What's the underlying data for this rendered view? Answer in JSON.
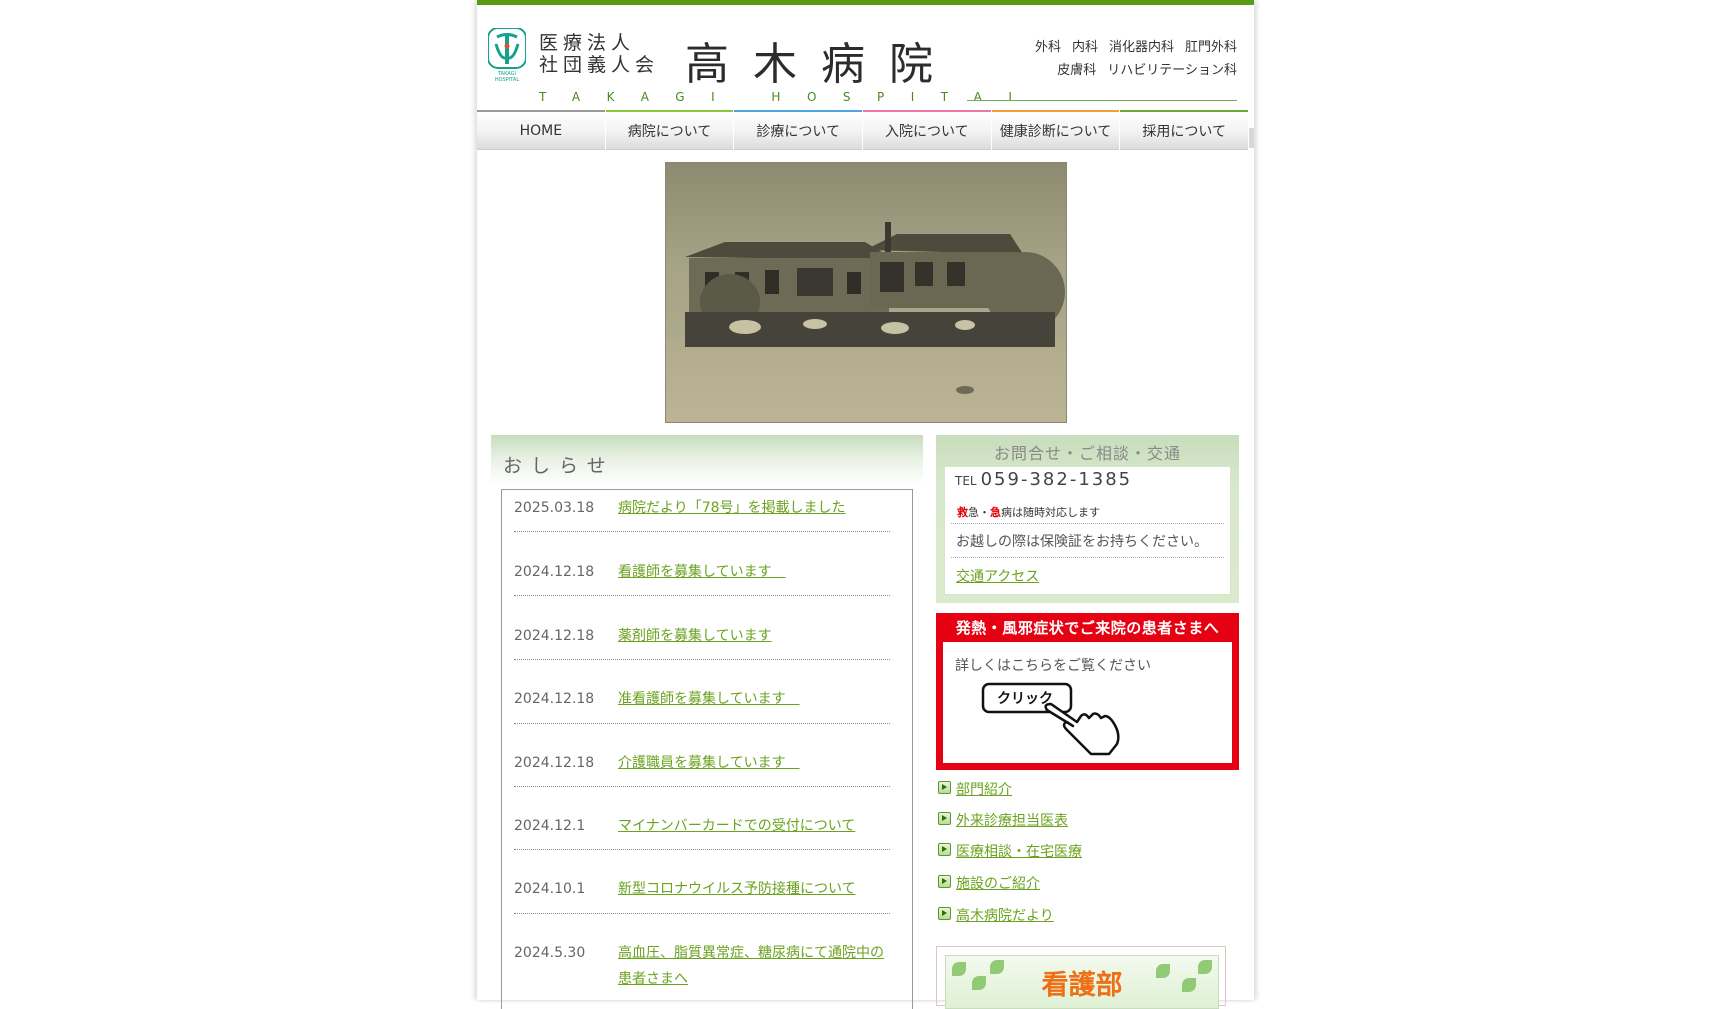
{
  "header": {
    "corp_line1": "医療法人",
    "corp_line2": "社団義人会",
    "hospital_name": "高木病院",
    "roman": "TAKAGI HOSPITAL",
    "logo_caption": "TAKAGI HOSPITAL",
    "departments_line1": [
      "外科",
      "内科",
      "消化器内科",
      "肛門外科"
    ],
    "departments_line2": [
      "皮膚科",
      "リハビリテーション科"
    ]
  },
  "nav": [
    {
      "label": "HOME",
      "accent": "#999999"
    },
    {
      "label": "病院について",
      "accent": "#8cc63f"
    },
    {
      "label": "診療について",
      "accent": "#4fa3e0"
    },
    {
      "label": "入院について",
      "accent": "#ec77a8"
    },
    {
      "label": "健康診断について",
      "accent": "#f39c3c"
    },
    {
      "label": "採用について",
      "accent": "#6aaa3a"
    }
  ],
  "news": {
    "title": "おしらせ",
    "items": [
      {
        "date": "2025.03.18",
        "text": "病院だより「78号」を掲載しました"
      },
      {
        "date": "2024.12.18",
        "text": "看護師を募集しています　"
      },
      {
        "date": "2024.12.18",
        "text": "薬剤師を募集しています"
      },
      {
        "date": "2024.12.18",
        "text": "准看護師を募集しています　"
      },
      {
        "date": "2024.12.18",
        "text": "介護職員を募集しています　"
      },
      {
        "date": "2024.12.1",
        "text": "マイナンバーカードでの受付について"
      },
      {
        "date": "2024.10.1",
        "text": "新型コロナウイルス予防接種について"
      },
      {
        "date": "2024.5.30",
        "text": "高血圧、脂質異常症、糖尿病にて通院中の患者さまへ"
      }
    ]
  },
  "contact": {
    "title": "お問合せ・ご相談・交通",
    "tel_label": "TEL",
    "tel": "059-382-1385",
    "emergency_a": "救",
    "emergency_b": "急・",
    "emergency_c": "急",
    "emergency_d": "病は随時対応します",
    "insurance_note": "お越しの際は保険証をお持ちください。",
    "access_link": "交通アクセス"
  },
  "fever": {
    "title": "発熱・風邪症状でご来院の患者さまへ",
    "text": "詳しくはこちらをご覧ください",
    "button": "クリック"
  },
  "side_links": [
    "部門紹介",
    "外来診療担当医表",
    "医療相談・在宅医療",
    "施設のご紹介",
    "高木病院だより"
  ],
  "nursing_banner": "看護部",
  "colors": {
    "brand_green": "#5a9a16",
    "link_green": "#6ba31f",
    "alert_red": "#e50012",
    "nurse_orange": "#ee6f14"
  }
}
